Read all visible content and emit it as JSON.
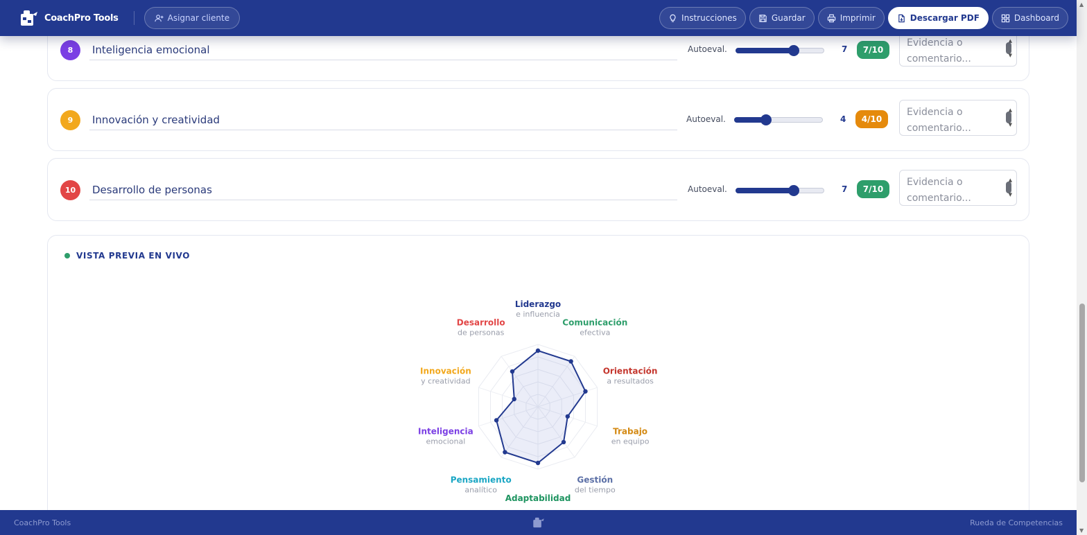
{
  "app": {
    "brand": "CoachPro Tools",
    "assign_label": "Asignar cliente"
  },
  "toolbar": {
    "instructions": "Instrucciones",
    "save": "Guardar",
    "print": "Imprimir",
    "download": "Descargar PDF",
    "dashboard": "Dashboard"
  },
  "competencies": [
    {
      "number": "8",
      "name": "Inteligencia emocional",
      "auto_label": "Autoeval.",
      "score": "7",
      "score_value": 7,
      "badge": "7/10",
      "color": "#7b3fe4",
      "badge_color": "#2e9e6b",
      "evidence_placeholder": "Evidencia o comentario..."
    },
    {
      "number": "9",
      "name": "Innovación y creatividad",
      "auto_label": "Autoeval.",
      "score": "4",
      "score_value": 4,
      "badge": "4/10",
      "color": "#f2a81d",
      "badge_color": "#e58a0c",
      "evidence_placeholder": "Evidencia o comentario..."
    },
    {
      "number": "10",
      "name": "Desarrollo de personas",
      "auto_label": "Autoeval.",
      "score": "7",
      "score_value": 7,
      "badge": "7/10",
      "color": "#e24646",
      "badge_color": "#2e9e6b",
      "evidence_placeholder": "Evidencia o comentario..."
    }
  ],
  "preview": {
    "title": "VISTA PREVIA EN VIVO"
  },
  "chart_data": {
    "type": "radar",
    "max": 10,
    "axes": [
      {
        "label": "Liderazgo",
        "sublabel": "e influencia",
        "color": "#22398f",
        "value": 9
      },
      {
        "label": "Comunicación",
        "sublabel": "efectiva",
        "color": "#2e9e6b",
        "value": 9
      },
      {
        "label": "Orientación",
        "sublabel": "a resultados",
        "color": "#c4362d",
        "value": 8
      },
      {
        "label": "Trabajo",
        "sublabel": "en equipo",
        "color": "#d48a14",
        "value": 5
      },
      {
        "label": "Gestión",
        "sublabel": "del tiempo",
        "color": "#5b6fa6",
        "value": 7
      },
      {
        "label": "Adaptabilidad",
        "sublabel": "",
        "color": "#1e9460",
        "value": 9
      },
      {
        "label": "Pensamiento",
        "sublabel": "analítico",
        "color": "#1aa6c4",
        "value": 9
      },
      {
        "label": "Inteligencia",
        "sublabel": "emocional",
        "color": "#7b3fe4",
        "value": 7
      },
      {
        "label": "Innovación",
        "sublabel": "y creatividad",
        "color": "#f2a81d",
        "value": 4
      },
      {
        "label": "Desarrollo",
        "sublabel": "de personas",
        "color": "#e24646",
        "value": 7
      }
    ]
  },
  "footer": {
    "left": "CoachPro Tools",
    "right": "Rueda de Competencias"
  }
}
